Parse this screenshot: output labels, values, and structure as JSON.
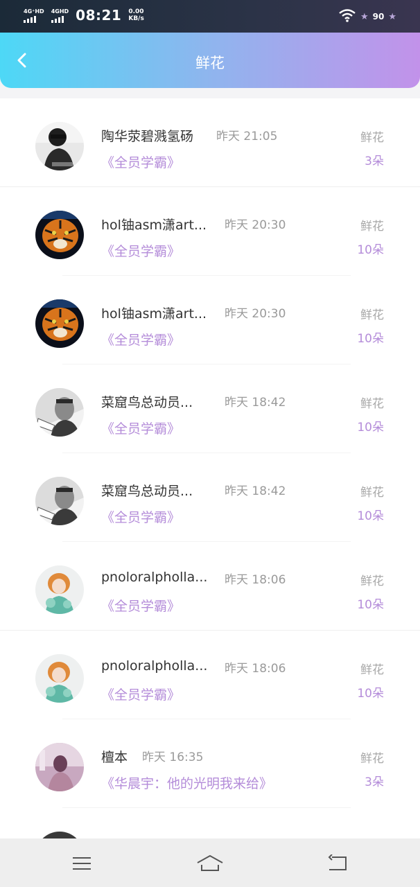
{
  "status_bar": {
    "signal1_label": "4G⁺HD",
    "signal2_label": "4GHD",
    "time": "08:21",
    "speed_value": "0.00",
    "speed_unit": "KB/s",
    "battery": "90"
  },
  "header": {
    "title": "鲜花"
  },
  "items": [
    {
      "name": "陶华荥碧溅氢砀",
      "time": "昨天 21:05",
      "book": "《全员学霸》",
      "gift_label": "鲜花",
      "gift_count": "3朵"
    },
    {
      "name": "hol铀asm潇art...",
      "time": "昨天 20:30",
      "book": "《全员学霸》",
      "gift_label": "鲜花",
      "gift_count": "10朵"
    },
    {
      "name": "hol铀asm潇art...",
      "time": "昨天 20:30",
      "book": "《全员学霸》",
      "gift_label": "鲜花",
      "gift_count": "10朵"
    },
    {
      "name": "菜窟鸟总动员...",
      "time": "昨天 18:42",
      "book": "《全员学霸》",
      "gift_label": "鲜花",
      "gift_count": "10朵"
    },
    {
      "name": "菜窟鸟总动员...",
      "time": "昨天 18:42",
      "book": "《全员学霸》",
      "gift_label": "鲜花",
      "gift_count": "10朵"
    },
    {
      "name": "pnoloralpholla...",
      "time": "昨天 18:06",
      "book": "《全员学霸》",
      "gift_label": "鲜花",
      "gift_count": "10朵"
    },
    {
      "name": "pnoloralpholla...",
      "time": "昨天 18:06",
      "book": "《全员学霸》",
      "gift_label": "鲜花",
      "gift_count": "10朵"
    },
    {
      "name": "檀本",
      "time": "昨天 16:35",
      "book": "《华晨宇：他的光明我来给》",
      "gift_label": "鲜花",
      "gift_count": "3朵"
    }
  ],
  "colors": {
    "accent_purple": "#b48cd9",
    "header_start": "#4dd8f6",
    "header_end": "#c292ea"
  }
}
